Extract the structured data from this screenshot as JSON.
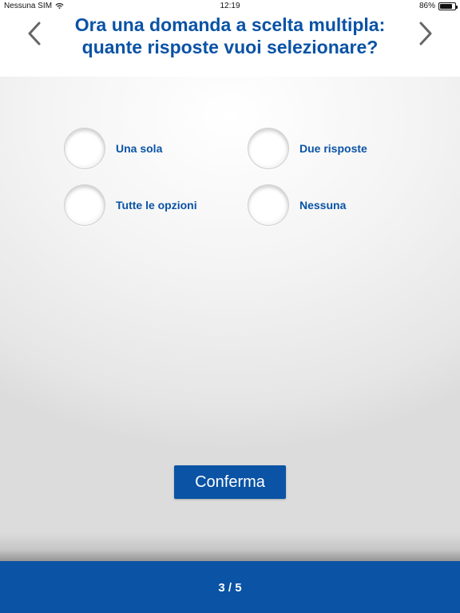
{
  "status_bar": {
    "carrier": "Nessuna SIM",
    "time": "12:19",
    "battery": "86%",
    "battery_level": 0.86,
    "icons": [
      "wifi-icon",
      "battery-icon"
    ]
  },
  "header": {
    "title": "Ora una domanda a scelta multipla:\nquante risposte vuoi selezionare?",
    "back_icon": "chevron-left-icon",
    "forward_icon": "chevron-right-icon"
  },
  "options": [
    {
      "label": "Una sola"
    },
    {
      "label": "Due risposte"
    },
    {
      "label": "Tutte le opzioni"
    },
    {
      "label": "Nessuna"
    }
  ],
  "confirm_label": "Conferma",
  "footer": {
    "page_indicator": "3 / 5"
  },
  "colors": {
    "accent": "#0a53a5",
    "footer_text": "#ffffff"
  }
}
